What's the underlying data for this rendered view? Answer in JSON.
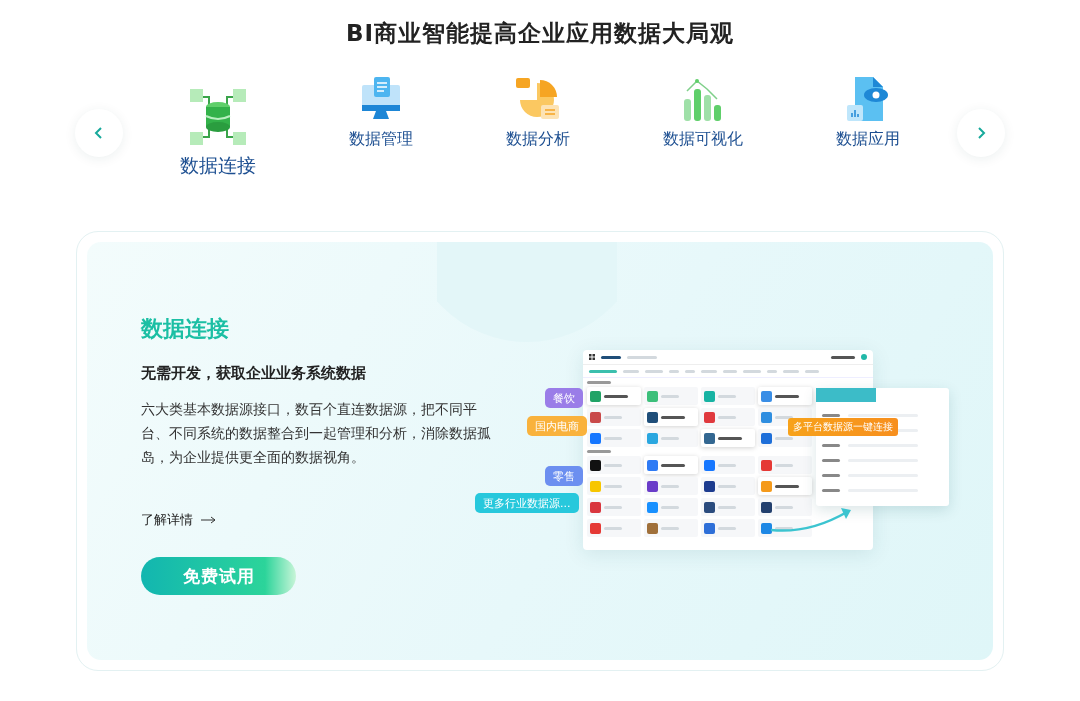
{
  "page_title": "BI商业智能提高企业应用数据大局观",
  "features": [
    {
      "kind": "connect",
      "label": "数据连接",
      "selected": true
    },
    {
      "kind": "manage",
      "label": "数据管理",
      "selected": false
    },
    {
      "kind": "analyze",
      "label": "数据分析",
      "selected": false
    },
    {
      "kind": "visualize",
      "label": "数据可视化",
      "selected": false
    },
    {
      "kind": "apply",
      "label": "数据应用",
      "selected": false
    }
  ],
  "detail": {
    "heading": "数据连接",
    "subtitle": "无需开发，获取企业业务系统数据",
    "description": "六大类基本数据源接口，数百个直连数据源，把不同平台、不同系统的数据整合到一起管理和分析，消除数据孤岛，为企业提供更全面的数据视角。",
    "link": "了解详情",
    "button": "免费试用"
  },
  "mockup": {
    "sections": [
      {
        "rows": [
          [
            {
              "color": "#21a366",
              "highlighted": true
            },
            {
              "color": "#3cbf7a",
              "highlighted": false
            },
            {
              "color": "#17b3a3",
              "highlighted": false
            },
            {
              "color": "#3a8ee6",
              "highlighted": true
            }
          ],
          [
            {
              "color": "#c94a4a",
              "highlighted": false
            },
            {
              "color": "#1f4e79",
              "highlighted": true
            },
            {
              "color": "#e0393e",
              "highlighted": false
            },
            {
              "color": "#2f8ee0",
              "highlighted": false
            }
          ],
          [
            {
              "color": "#1677ff",
              "highlighted": false
            },
            {
              "color": "#2aa7e0",
              "highlighted": false
            },
            {
              "color": "#336791",
              "highlighted": true
            },
            {
              "color": "#1e6fd9",
              "highlighted": false
            }
          ]
        ]
      },
      {
        "rows": [
          [
            {
              "color": "#111111",
              "highlighted": false
            },
            {
              "color": "#2f7bf5",
              "highlighted": true
            },
            {
              "color": "#1677ff",
              "highlighted": false
            },
            {
              "color": "#e53935",
              "highlighted": false
            }
          ],
          [
            {
              "color": "#f7c600",
              "highlighted": false
            },
            {
              "color": "#6a3cc9",
              "highlighted": false
            },
            {
              "color": "#1d3c8f",
              "highlighted": false
            },
            {
              "color": "#f59a1b",
              "highlighted": true
            }
          ],
          [
            {
              "color": "#d9363e",
              "highlighted": false
            },
            {
              "color": "#1890ff",
              "highlighted": false
            },
            {
              "color": "#2b4c7e",
              "highlighted": false
            },
            {
              "color": "#23406e",
              "highlighted": false
            }
          ],
          [
            {
              "color": "#e53935",
              "highlighted": false
            },
            {
              "color": "#a0703a",
              "highlighted": false
            },
            {
              "color": "#2e6fd8",
              "highlighted": false
            },
            {
              "color": "#1e88e5",
              "highlighted": false
            }
          ]
        ]
      }
    ],
    "tags": [
      {
        "label": "餐饮",
        "color": "#9a7de8"
      },
      {
        "label": "国内电商",
        "color": "#f9b23c"
      },
      {
        "label": "零售",
        "color": "#6c8ff0"
      },
      {
        "label": "更多行业数据源...",
        "color": "#27c8dc"
      }
    ],
    "callout": "多平台数据源一键连接"
  }
}
